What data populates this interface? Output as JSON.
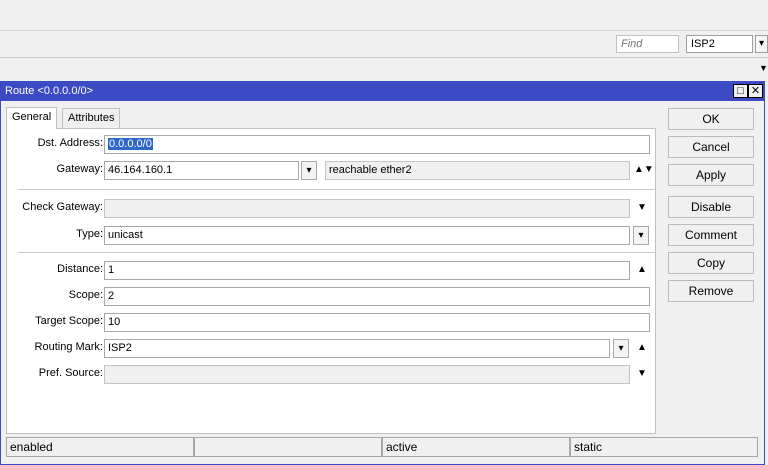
{
  "toolbar": {
    "find_placeholder": "Find",
    "filter_value": "ISP2"
  },
  "window": {
    "title": "Route <0.0.0.0/0>"
  },
  "tabs": [
    {
      "label": "General"
    },
    {
      "label": "Attributes"
    }
  ],
  "form": {
    "dst_address": {
      "label": "Dst. Address:",
      "value": "0.0.0.0/0"
    },
    "gateway": {
      "label": "Gateway:",
      "value": "46.164.160.1",
      "status": "reachable ether2"
    },
    "check_gateway": {
      "label": "Check Gateway:",
      "value": ""
    },
    "type": {
      "label": "Type:",
      "value": "unicast"
    },
    "distance": {
      "label": "Distance:",
      "value": "1"
    },
    "scope": {
      "label": "Scope:",
      "value": "2"
    },
    "target_scope": {
      "label": "Target Scope:",
      "value": "10"
    },
    "routing_mark": {
      "label": "Routing Mark:",
      "value": "ISP2"
    },
    "pref_source": {
      "label": "Pref. Source:",
      "value": ""
    }
  },
  "buttons": {
    "ok": "OK",
    "cancel": "Cancel",
    "apply": "Apply",
    "disable": "Disable",
    "comment": "Comment",
    "copy": "Copy",
    "remove": "Remove"
  },
  "status_bar": [
    "enabled",
    "",
    "active",
    "static"
  ],
  "colors": {
    "title_bar": "#3c4bc4",
    "selection": "#3168c8"
  }
}
